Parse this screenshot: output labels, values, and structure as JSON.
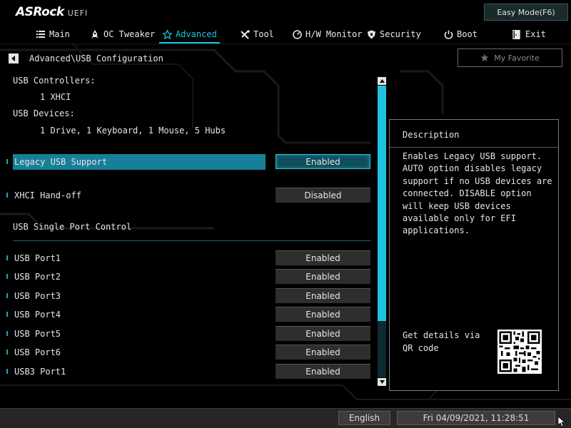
{
  "header": {
    "brand": "ASRock",
    "subbrand": "UEFI",
    "easy_mode_label": "Easy Mode(F6)"
  },
  "menu": {
    "tabs": [
      {
        "label": "Main",
        "icon": "list-icon"
      },
      {
        "label": "OC Tweaker",
        "icon": "rocket-icon"
      },
      {
        "label": "Advanced",
        "icon": "star-icon",
        "active": true
      },
      {
        "label": "Tool",
        "icon": "tools-icon"
      },
      {
        "label": "H/W Monitor",
        "icon": "monitor-icon"
      },
      {
        "label": "Security",
        "icon": "shield-icon"
      },
      {
        "label": "Boot",
        "icon": "power-icon"
      },
      {
        "label": "Exit",
        "icon": "exit-icon"
      }
    ]
  },
  "breadcrumb": "Advanced\\USB Configuration",
  "favorite_label": "My Favorite",
  "info": {
    "controllers_label": "USB Controllers:",
    "controllers_value": "1 XHCI",
    "devices_label": "USB Devices:",
    "devices_value": "1 Drive, 1 Keyboard, 1 Mouse, 5 Hubs"
  },
  "settings": [
    {
      "label": "Legacy USB Support",
      "value": "Enabled",
      "selected": true
    },
    {
      "label": "XHCI Hand-off",
      "value": "Disabled"
    }
  ],
  "section_label": "USB Single Port Control",
  "ports": [
    {
      "label": "USB Port1",
      "value": "Enabled"
    },
    {
      "label": "USB Port2",
      "value": "Enabled"
    },
    {
      "label": "USB Port3",
      "value": "Enabled"
    },
    {
      "label": "USB Port4",
      "value": "Enabled"
    },
    {
      "label": "USB Port5",
      "value": "Enabled"
    },
    {
      "label": "USB Port6",
      "value": "Enabled"
    },
    {
      "label": "USB3 Port1",
      "value": "Enabled"
    }
  ],
  "scroll_position_fraction": 0.8,
  "description": {
    "title": "Description",
    "text": "Enables Legacy USB support. AUTO option disables legacy support if no USB devices are connected. DISABLE option will keep USB devices available only for EFI applications.",
    "qr_text": "Get details via QR code"
  },
  "footer": {
    "language": "English",
    "datetime": "Fri 04/09/2021, 11:28:51"
  },
  "colors": {
    "accent": "#19c7e6",
    "highlight_row": "#177f98",
    "background": "#000000"
  }
}
